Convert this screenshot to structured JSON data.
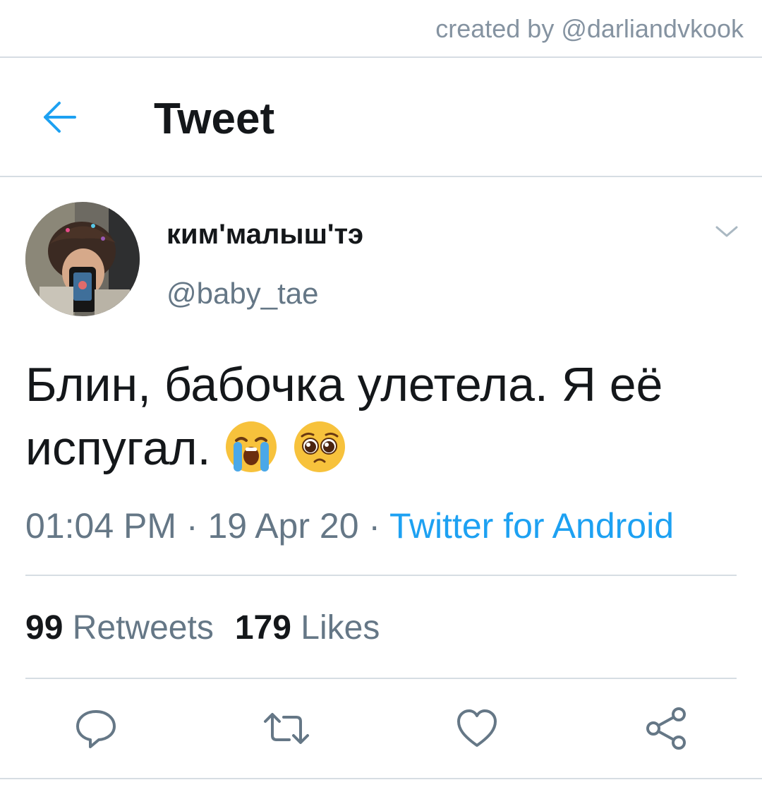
{
  "watermark": "created by @darliandvkook",
  "header": {
    "title": "Tweet",
    "back_icon": "arrow-left-icon"
  },
  "user": {
    "display_name": "ким'малыш'тэ",
    "handle": "@baby_tae"
  },
  "tweet": {
    "text": "Блин, бабочка улетела. Я её испугал.",
    "emojis": [
      "loudly-crying-face",
      "pleading-face"
    ],
    "time": "01:04 PM",
    "date": "19 Apr 20",
    "separator": " · ",
    "source": "Twitter for Android"
  },
  "stats": {
    "retweets_count": "99",
    "retweets_label": "Retweets",
    "likes_count": "179",
    "likes_label": "Likes"
  },
  "actions": [
    "reply-icon",
    "retweet-icon",
    "like-icon",
    "share-icon"
  ],
  "colors": {
    "accent": "#1da1f2",
    "secondary_text": "#657786",
    "primary_text": "#14171a",
    "divider": "#d6dde3"
  }
}
